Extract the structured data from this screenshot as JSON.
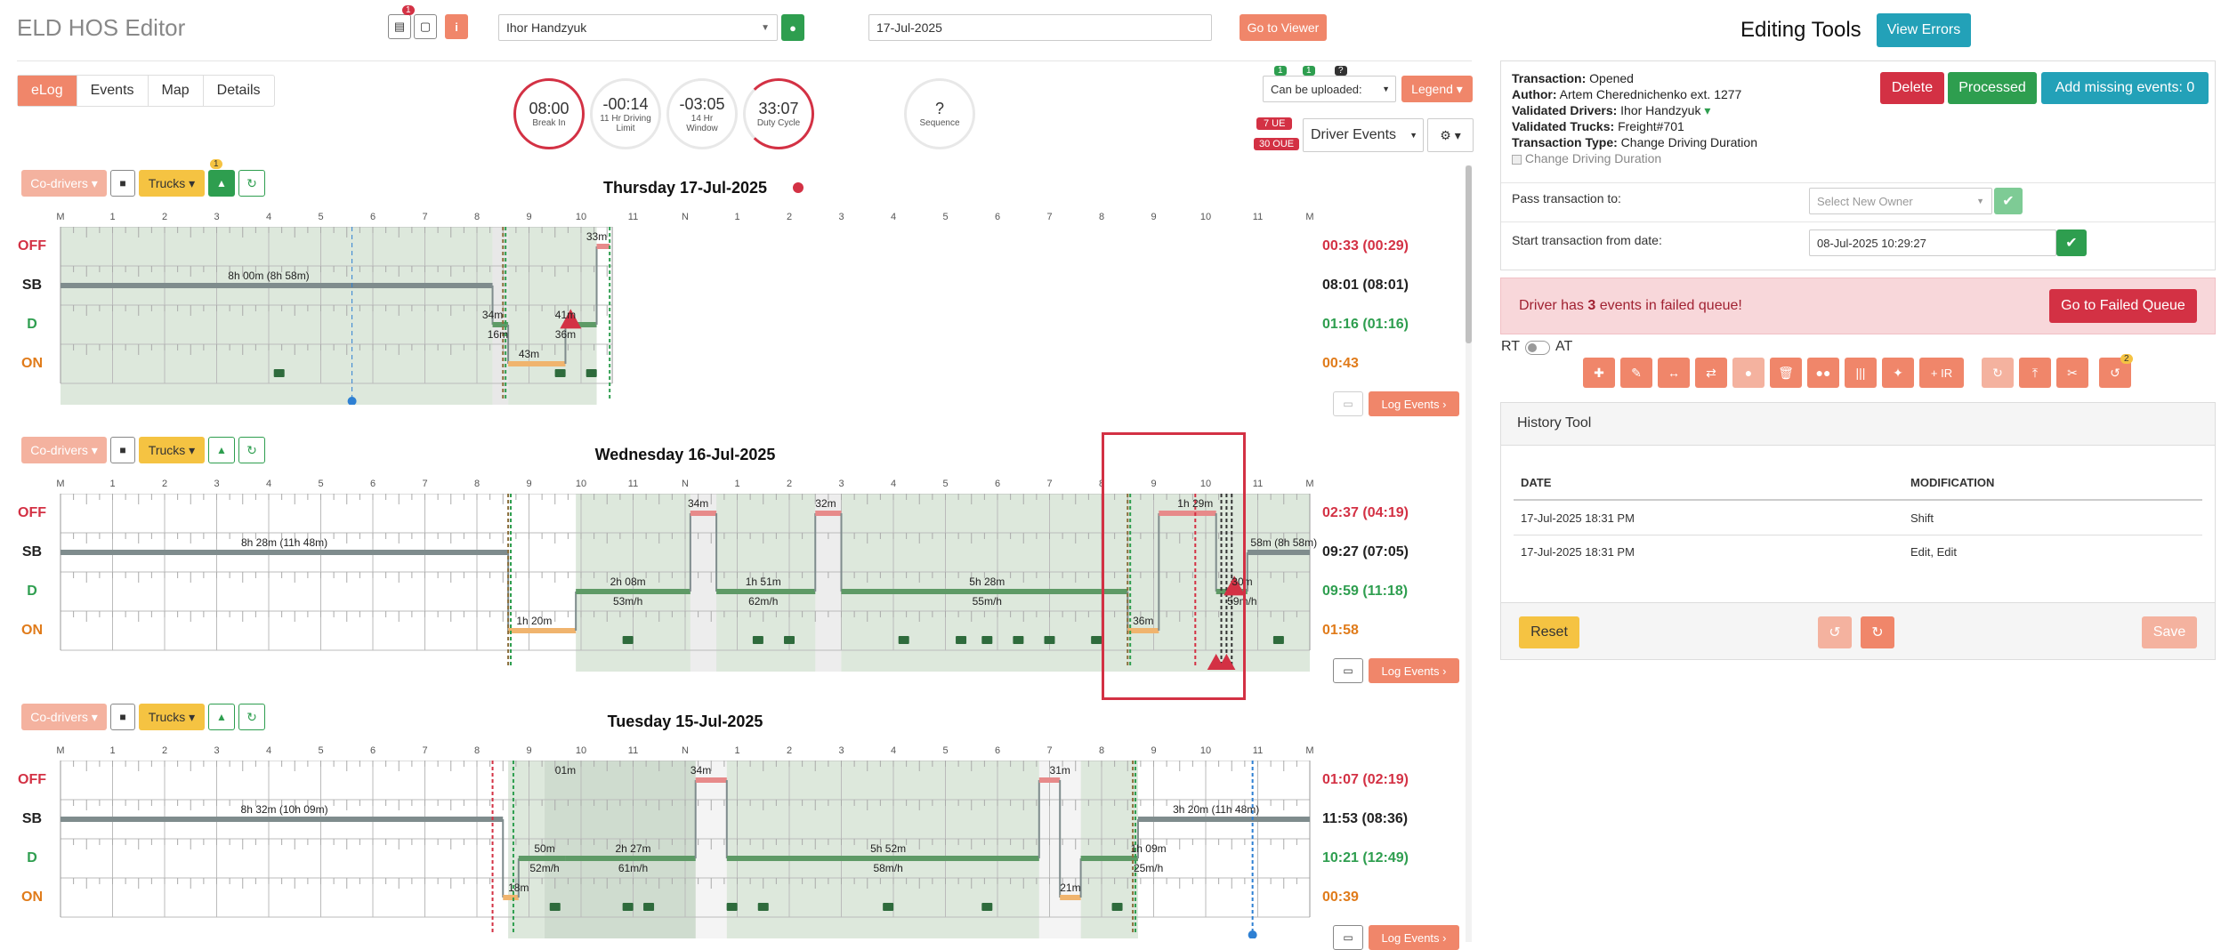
{
  "header": {
    "title": "ELD HOS Editor",
    "notes_badge": "1",
    "driver_select": "Ihor Handzyuk",
    "date_input": "17-Jul-2025",
    "go_viewer": "Go to Viewer"
  },
  "view_tabs": [
    "eLog",
    "Events",
    "Map",
    "Details"
  ],
  "circles": [
    {
      "value": "08:00",
      "label": "Break In"
    },
    {
      "value": "-00:14",
      "label": "11 Hr Driving Limit"
    },
    {
      "value": "-03:05",
      "label": "14 Hr Window"
    },
    {
      "value": "33:07",
      "label": "Duty Cycle"
    },
    {
      "value": "?",
      "label": "Sequence"
    }
  ],
  "right_controls": {
    "badge_a": "1",
    "badge_b": "1",
    "badge_c": "?",
    "upload_select": "Can be uploaded:",
    "legend": "Legend",
    "ue_badge": "7 UE",
    "oue_badge": "30 OUE",
    "driver_events": "Driver Events"
  },
  "day_toolbar": {
    "codrivers": "Co-drivers",
    "trucks": "Trucks",
    "trailer_badge": "1"
  },
  "hour_labels": [
    "M",
    "1",
    "2",
    "3",
    "4",
    "5",
    "6",
    "7",
    "8",
    "9",
    "10",
    "11",
    "N",
    "1",
    "2",
    "3",
    "4",
    "5",
    "6",
    "7",
    "8",
    "9",
    "10",
    "11",
    "M"
  ],
  "row_labels": [
    "OFF",
    "SB",
    "D",
    "ON"
  ],
  "log_events_label": "Log Events",
  "days": [
    {
      "title": "Thursday 17-Jul-2025",
      "totals": [
        "00:33 (00:29)",
        "08:01 (08:01)",
        "01:16 (01:16)",
        "00:43"
      ],
      "labels": [
        {
          "text": "8h 00m (8h 58m)",
          "h": 4.0,
          "row": 1
        },
        {
          "text": "33m",
          "h": 10.3,
          "row": 0
        },
        {
          "text": "34m",
          "h": 8.3,
          "row": 2
        },
        {
          "text": "16m",
          "h": 8.4,
          "row": 2.5
        },
        {
          "text": "41m",
          "h": 9.7,
          "row": 2
        },
        {
          "text": "36m",
          "h": 9.7,
          "row": 2.5
        },
        {
          "text": "43m",
          "h": 9.0,
          "row": 3
        }
      ]
    },
    {
      "title": "Wednesday 16-Jul-2025",
      "totals": [
        "02:37 (04:19)",
        "09:27 (07:05)",
        "09:59 (11:18)",
        "01:58"
      ],
      "labels": [
        {
          "text": "8h 28m (11h 48m)",
          "h": 4.3,
          "row": 1
        },
        {
          "text": "34m",
          "h": 12.25,
          "row": 0
        },
        {
          "text": "32m",
          "h": 14.7,
          "row": 0
        },
        {
          "text": "1h 29m",
          "h": 21.8,
          "row": 0
        },
        {
          "text": "58m (8h 58m)",
          "h": 23.5,
          "row": 1
        },
        {
          "text": "2h 08m",
          "h": 10.9,
          "row": 2
        },
        {
          "text": "53m/h",
          "h": 10.9,
          "row": 2.5
        },
        {
          "text": "1h 51m",
          "h": 13.5,
          "row": 2
        },
        {
          "text": "62m/h",
          "h": 13.5,
          "row": 2.5
        },
        {
          "text": "5h 28m",
          "h": 17.8,
          "row": 2
        },
        {
          "text": "55m/h",
          "h": 17.8,
          "row": 2.5
        },
        {
          "text": "30m",
          "h": 22.7,
          "row": 2
        },
        {
          "text": "59m/h",
          "h": 22.7,
          "row": 2.5
        },
        {
          "text": "1h 20m",
          "h": 9.1,
          "row": 3
        },
        {
          "text": "36m",
          "h": 20.8,
          "row": 3
        }
      ]
    },
    {
      "title": "Tuesday 15-Jul-2025",
      "totals": [
        "01:07 (02:19)",
        "11:53 (08:36)",
        "10:21 (12:49)",
        "00:39"
      ],
      "labels": [
        {
          "text": "8h 32m (10h 09m)",
          "h": 4.3,
          "row": 1
        },
        {
          "text": "01m",
          "h": 9.7,
          "row": 0
        },
        {
          "text": "34m",
          "h": 12.3,
          "row": 0
        },
        {
          "text": "31m",
          "h": 19.2,
          "row": 0
        },
        {
          "text": "3h 20m (11h 48m)",
          "h": 22.2,
          "row": 1
        },
        {
          "text": "50m",
          "h": 9.3,
          "row": 2
        },
        {
          "text": "52m/h",
          "h": 9.3,
          "row": 2.5
        },
        {
          "text": "2h 27m",
          "h": 11.0,
          "row": 2
        },
        {
          "text": "61m/h",
          "h": 11.0,
          "row": 2.5
        },
        {
          "text": "5h 52m",
          "h": 15.9,
          "row": 2
        },
        {
          "text": "58m/h",
          "h": 15.9,
          "row": 2.5
        },
        {
          "text": "1h 09m",
          "h": 20.9,
          "row": 2
        },
        {
          "text": "25m/h",
          "h": 20.9,
          "row": 2.5
        },
        {
          "text": "18m",
          "h": 8.8,
          "row": 3
        },
        {
          "text": "21m",
          "h": 19.4,
          "row": 3
        }
      ]
    }
  ],
  "editing": {
    "title": "Editing Tools",
    "view_errors": "View Errors",
    "info": [
      {
        "k": "Transaction:",
        "v": "Opened"
      },
      {
        "k": "Author:",
        "v": "Artem Cherednichenko ext. 1277"
      },
      {
        "k": "Validated Drivers:",
        "v": "Ihor Handzyuk"
      },
      {
        "k": "Validated Trucks:",
        "v": "Freight#701"
      },
      {
        "k": "Transaction Type:",
        "v": "Change Driving Duration"
      }
    ],
    "checkbox_label": "Change Driving Duration",
    "delete": "Delete",
    "processed": "Processed",
    "add_missing": "Add missing events: 0",
    "pass_label": "Pass transaction to:",
    "owner_placeholder": "Select New Owner",
    "start_label": "Start transaction from date:",
    "start_value": "08-Jul-2025 10:29:27",
    "failed_pre": "Driver has",
    "failed_count": "3",
    "failed_post": "events in failed queue!",
    "failed_btn": "Go to Failed Queue",
    "rt": "RT",
    "at": "AT",
    "tools_ir": "+ IR",
    "tools_badge": "2",
    "history_title": "History Tool",
    "history_cols": [
      "DATE",
      "MODIFICATION"
    ],
    "history_rows": [
      {
        "date": "17-Jul-2025 18:31 PM",
        "mod": "Shift"
      },
      {
        "date": "17-Jul-2025 18:31 PM",
        "mod": "Edit, Edit"
      }
    ],
    "reset": "Reset",
    "save": "Save"
  }
}
